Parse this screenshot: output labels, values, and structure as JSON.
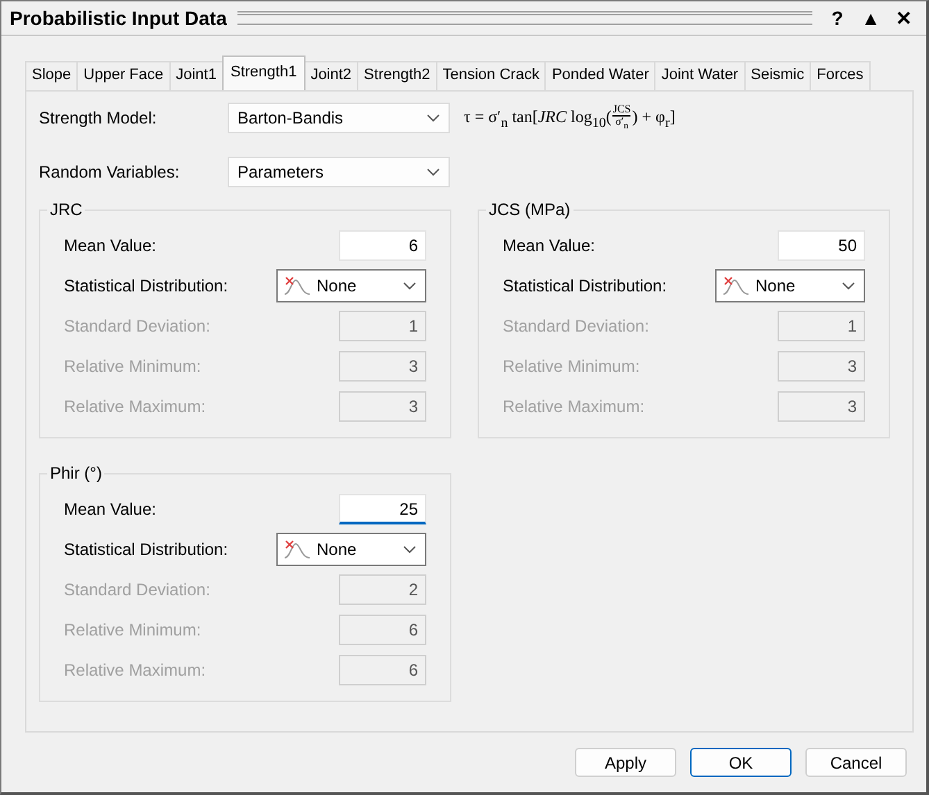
{
  "window": {
    "title": "Probabilistic Input Data",
    "controls": [
      "?",
      "▲",
      "✕"
    ]
  },
  "tabs": [
    {
      "label": "Slope",
      "selected": false
    },
    {
      "label": "Upper Face",
      "selected": false
    },
    {
      "label": "Joint1",
      "selected": false
    },
    {
      "label": "Strength1",
      "selected": true
    },
    {
      "label": "Joint2",
      "selected": false
    },
    {
      "label": "Strength2",
      "selected": false
    },
    {
      "label": "Tension Crack",
      "selected": false
    },
    {
      "label": "Ponded Water",
      "selected": false
    },
    {
      "label": "Joint Water",
      "selected": false
    },
    {
      "label": "Seismic",
      "selected": false
    },
    {
      "label": "Forces",
      "selected": false
    }
  ],
  "strength_model": {
    "label": "Strength Model:",
    "value": "Barton-Bandis"
  },
  "formula": {
    "before": "τ = σ′$_{n}$ tan[*JRC* log$_{10}$(",
    "numerator": "JCS",
    "denominator": "σ′$_{n}$",
    "after": ") + φ$_{r}$]"
  },
  "random_variables": {
    "label": "Random Variables:",
    "value": "Parameters"
  },
  "groups": [
    {
      "title": "JRC",
      "fields": [
        {
          "kind": "text",
          "label": "Mean Value:",
          "value": "6",
          "disabled": false,
          "focused": false
        },
        {
          "kind": "dropdown",
          "label": "Statistical Distribution:",
          "value": "None",
          "disabled": false
        },
        {
          "kind": "text",
          "label": "Standard Deviation:",
          "value": "1",
          "disabled": true,
          "focused": false
        },
        {
          "kind": "text",
          "label": "Relative Minimum:",
          "value": "3",
          "disabled": true,
          "focused": false
        },
        {
          "kind": "text",
          "label": "Relative Maximum:",
          "value": "3",
          "disabled": true,
          "focused": false
        }
      ]
    },
    {
      "title": "JCS (MPa)",
      "fields": [
        {
          "kind": "text",
          "label": "Mean Value:",
          "value": "50",
          "disabled": false,
          "focused": false
        },
        {
          "kind": "dropdown",
          "label": "Statistical Distribution:",
          "value": "None",
          "disabled": false
        },
        {
          "kind": "text",
          "label": "Standard Deviation:",
          "value": "1",
          "disabled": true,
          "focused": false
        },
        {
          "kind": "text",
          "label": "Relative Minimum:",
          "value": "3",
          "disabled": true,
          "focused": false
        },
        {
          "kind": "text",
          "label": "Relative Maximum:",
          "value": "3",
          "disabled": true,
          "focused": false
        }
      ]
    },
    {
      "title": "Phir (°)",
      "fields": [
        {
          "kind": "text",
          "label": "Mean Value:",
          "value": "25",
          "disabled": false,
          "focused": true
        },
        {
          "kind": "dropdown",
          "label": "Statistical Distribution:",
          "value": "None",
          "disabled": false
        },
        {
          "kind": "text",
          "label": "Standard Deviation:",
          "value": "2",
          "disabled": true,
          "focused": false
        },
        {
          "kind": "text",
          "label": "Relative Minimum:",
          "value": "6",
          "disabled": true,
          "focused": false
        },
        {
          "kind": "text",
          "label": "Relative Maximum:",
          "value": "6",
          "disabled": true,
          "focused": false
        }
      ]
    }
  ],
  "buttons": [
    {
      "label": "Apply",
      "default": false
    },
    {
      "label": "OK",
      "default": true
    },
    {
      "label": "Cancel",
      "default": false
    }
  ]
}
